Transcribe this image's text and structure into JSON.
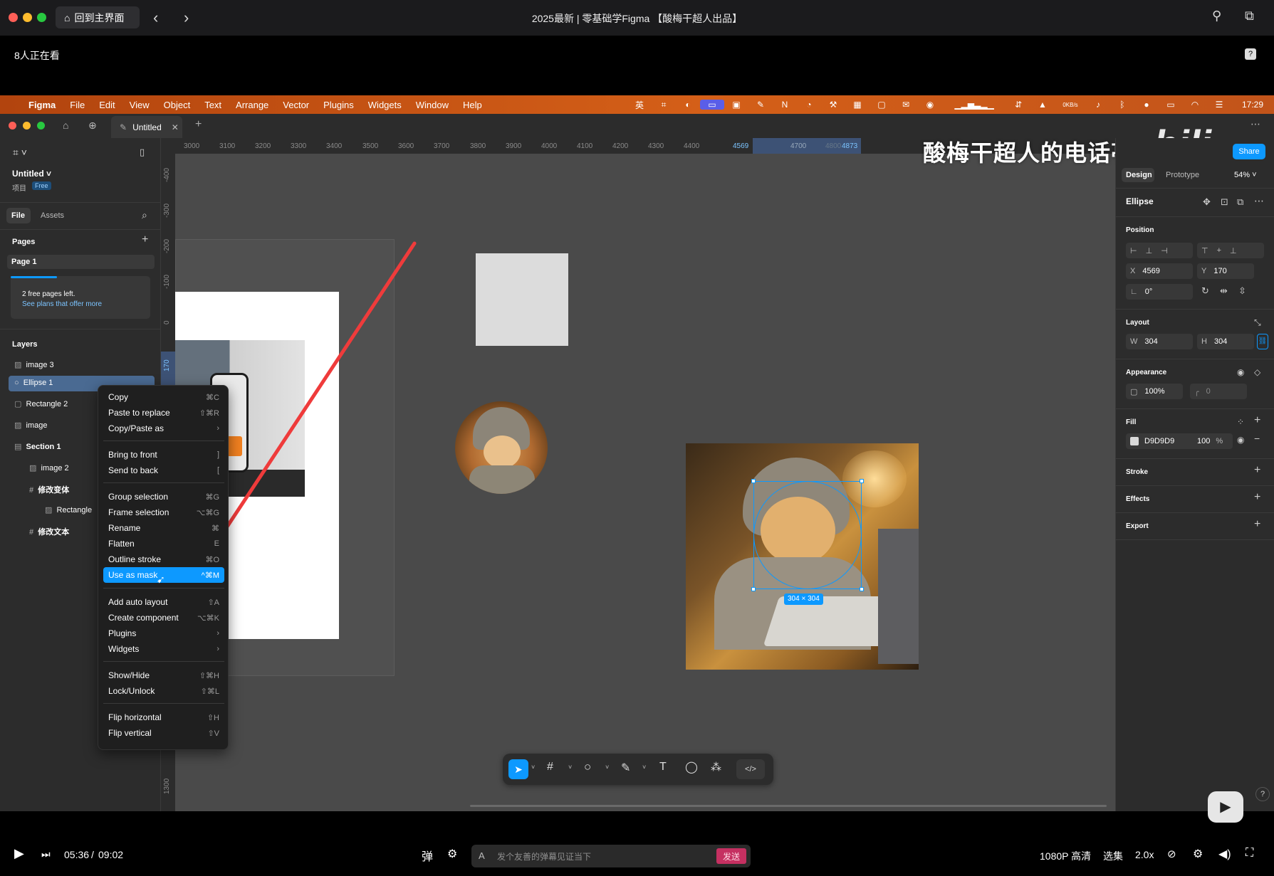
{
  "browser": {
    "home_label": "回到主界面",
    "title": "2025最新 | 零基础学Figma 【酸梅干超人出品】",
    "viewers": "8人正在看"
  },
  "macmenu": {
    "items": [
      "Figma",
      "File",
      "Edit",
      "View",
      "Object",
      "Text",
      "Arrange",
      "Vector",
      "Plugins",
      "Widgets",
      "Window",
      "Help"
    ],
    "net": "0KB/s",
    "clock": "17:29"
  },
  "figma": {
    "tab_name": "Untitled",
    "file_name": "Untitled",
    "project_label": "项目",
    "plan_badge": "Free",
    "tab_file": "File",
    "tab_assets": "Assets",
    "pages_title": "Pages",
    "page1": "Page 1",
    "free_pages_notice": "2 free pages left.",
    "plans_link": "See plans that offer more",
    "layers_title": "Layers",
    "layers": [
      "image 3",
      "Ellipse 1",
      "Rectangle 2",
      "image",
      "Section 1",
      "image 2",
      "修改变体",
      "Rectangle",
      "修改文本"
    ],
    "watermark": "酸梅干超人的电话亭",
    "share": "Share"
  },
  "ruler": {
    "top": [
      "3000",
      "3100",
      "3200",
      "3300",
      "3400",
      "3500",
      "3600",
      "3700",
      "3800",
      "3900",
      "4000",
      "4100",
      "4200",
      "4300",
      "4400",
      "4569",
      "4700",
      "4800",
      "4873"
    ],
    "left": [
      "-400",
      "-300",
      "-200",
      "-100",
      "0",
      "170",
      "1300"
    ]
  },
  "context_menu": [
    {
      "label": "Copy",
      "shortcut": "⌘C"
    },
    {
      "label": "Paste to replace",
      "shortcut": "⇧⌘R"
    },
    {
      "label": "Copy/Paste as",
      "shortcut": "›"
    },
    {
      "label": "Bring to front",
      "shortcut": "]"
    },
    {
      "label": "Send to back",
      "shortcut": "["
    },
    {
      "label": "Group selection",
      "shortcut": "⌘G"
    },
    {
      "label": "Frame selection",
      "shortcut": "⌥⌘G"
    },
    {
      "label": "Rename",
      "shortcut": "⌘"
    },
    {
      "label": "Flatten",
      "shortcut": "E"
    },
    {
      "label": "Outline stroke",
      "shortcut": "⌘O"
    },
    {
      "label": "Use as mask",
      "shortcut": "^⌘M"
    },
    {
      "label": "Add auto layout",
      "shortcut": "⇧A"
    },
    {
      "label": "Create component",
      "shortcut": "⌥⌘K"
    },
    {
      "label": "Plugins",
      "shortcut": "›"
    },
    {
      "label": "Widgets",
      "shortcut": "›"
    },
    {
      "label": "Show/Hide",
      "shortcut": "⇧⌘H"
    },
    {
      "label": "Lock/Unlock",
      "shortcut": "⇧⌘L"
    },
    {
      "label": "Flip horizontal",
      "shortcut": "⇧H"
    },
    {
      "label": "Flip vertical",
      "shortcut": "⇧V"
    }
  ],
  "selection_size": "304 × 304",
  "design_panel": {
    "tab_design": "Design",
    "tab_prototype": "Prototype",
    "zoom": "54%",
    "node_name": "Ellipse",
    "position": "Position",
    "x_label": "X",
    "x_value": "4569",
    "y_label": "Y",
    "y_value": "170",
    "rotation": "0°",
    "layout": "Layout",
    "w_label": "W",
    "w_value": "304",
    "h_label": "H",
    "h_value": "304",
    "appearance": "Appearance",
    "opacity": "100%",
    "radius": "0",
    "fill": "Fill",
    "fill_hex": "D9D9D9",
    "fill_opacity": "100",
    "fill_pct": "%",
    "stroke": "Stroke",
    "effects": "Effects",
    "export": "Export"
  },
  "video": {
    "current": "05:36",
    "sep": "/",
    "total": "09:02",
    "danmu_placeholder": "发个友善的弹幕见证当下",
    "send": "发送",
    "quality": "1080P 高清",
    "episodes": "选集",
    "speed": "2.0x"
  }
}
